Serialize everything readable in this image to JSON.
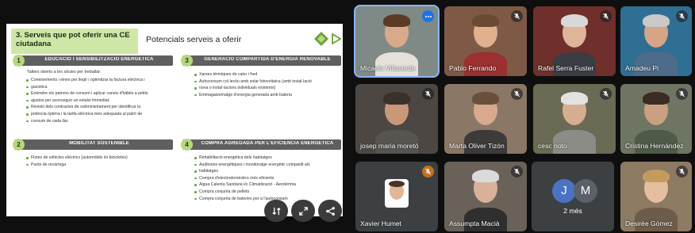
{
  "slide": {
    "title": "3. Serveis que pot oferir una CE ciutadana",
    "subtitle": "Potencials serveis a oferir",
    "sections": [
      {
        "num": "1",
        "title": "EDUCACIÓ I SENSIBILITZACIÓ ENERGÈTICA",
        "intro": "Tallers oberts a les sòcies per treballar:",
        "items": [
          "Coneixements i eines per llegir i optimitzar la factura elèctrica i",
          "gasística",
          "Entendre els patrons de consum i aplicar canvis d'hàbits a petits",
          "ajustos per aconseguir un estalvi immediat.",
          "Revisió dels contractes de subministrament per identificar la",
          "potència òptima i la tarifa elèctrica més adequada al patró de",
          "consum de cada llar."
        ]
      },
      {
        "num": "2",
        "title": "MOBILITAT SOSTENIBLE",
        "intro": "",
        "items": [
          "Flotes de vehicles elèctrics (automòbils i/o bicicletes)",
          "Punts de recàrrega"
        ]
      },
      {
        "num": "3",
        "title": "GENERACIÓ COMPARTIDA D'ENERGIA RENOVABLE",
        "intro": "",
        "items": [
          "Xarxes tèrmiques de calor i fred",
          "Autoconsum col·lectiu amb solar fotovoltaica (amb instal·lació",
          "nova o instal·lacions individuals existents)",
          "Emmagatzematge d'energia generada amb bateria"
        ]
      },
      {
        "num": "4",
        "title": "COMPRA AGREGADA PER L'EFICIÈNCIA ENERGÈTICA",
        "intro": "",
        "items": [
          "Rehabilitació energètica dels habitatges",
          "Auditories energètiques i monitoratge energètic compartit als",
          "habitatges",
          "Compra d'electrodomèstics més eficients",
          "Aigua Calenta Sanitària i/o Climatització - Aerotèrmia",
          "Compra conjunta de pellets",
          "Compra conjunta de bateries per a l'autoconsum"
        ]
      }
    ]
  },
  "slide_controls": [
    "sync-icon",
    "fullscreen-icon",
    "share-icon"
  ],
  "participants": [
    {
      "name": "Micaela Villaverde",
      "state": "speaking",
      "bg": "#7f8a86",
      "skin": "#d9aa8a",
      "hair": "#5b3a26",
      "shirt": "#e5e1da"
    },
    {
      "name": "Pablo Ferrando",
      "state": "muted",
      "bg": "#7e5a46",
      "skin": "#e0b08f",
      "hair": "#6b4a33",
      "shirt": "#9c2f2f"
    },
    {
      "name": "Rafel Serra Fuster",
      "state": "muted",
      "bg": "#6f2f2a",
      "skin": "#dfb49b",
      "hair": "#d8d8d8",
      "shirt": "#3a3d44"
    },
    {
      "name": "Amadeu Pi",
      "state": "muted",
      "bg": "#2f6f93",
      "skin": "#d6a588",
      "hair": "#c9c9c9",
      "shirt": "#4d6c89"
    },
    {
      "name": "josep maria moretó",
      "state": "muted",
      "bg": "#4c4742",
      "skin": "#c89878",
      "hair": "#3a312b",
      "shirt": "#575552"
    },
    {
      "name": "Marta Oliver Tizón",
      "state": "muted",
      "bg": "#8b7766",
      "skin": "#d8a98c",
      "hair": "#6a4f3c",
      "shirt": "#3d3a3a"
    },
    {
      "name": "cesc noto",
      "state": "muted",
      "bg": "#6a6a55",
      "skin": "#d7ad91",
      "hair": "#e2e2e2",
      "shirt": "#8c8c87"
    },
    {
      "name": "Cristina Hernández",
      "state": "muted",
      "bg": "#6f7563",
      "skin": "#c9a080",
      "hair": "#3a2c22",
      "shirt": "#4f5a48"
    },
    {
      "name": "Xavier Humet",
      "state": "muted-orange",
      "bg": "#3c4043",
      "skin": "#e1b596",
      "hair": "#4a3326",
      "shirt": "#ffffff"
    },
    {
      "name": "Assumpta Macià",
      "state": "muted",
      "bg": "#6a6259",
      "skin": "#d9b19a",
      "hair": "#dadada",
      "shirt": "#2f2f2f"
    },
    {
      "name": "Desirée Gómez",
      "state": "muted",
      "bg": "#8c7a63",
      "skin": "#e3be9f",
      "hair": "#c49a5e",
      "shirt": "#6e5c4a"
    }
  ],
  "overflow_tile": {
    "avatars": [
      {
        "initial": "J",
        "color": "#4a73c4"
      },
      {
        "initial": "M",
        "color": "#5b6168"
      }
    ],
    "label": "2 més"
  },
  "colors": {
    "accent_green": "#b6d77c",
    "section_bar": "#5f5f5f",
    "speaking_blue": "#8ab4f8",
    "tile_bg": "#3c4043"
  }
}
